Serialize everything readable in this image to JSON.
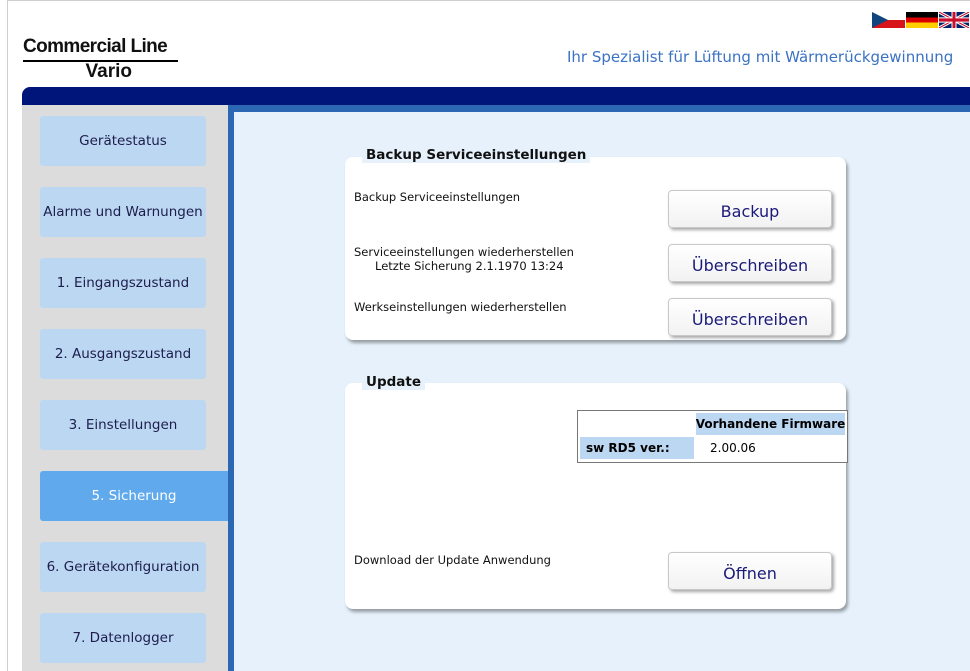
{
  "header": {
    "logo_line1": "Commercial Line",
    "logo_line2": "Vario",
    "tagline": "Ihr Spezialist für Lüftung mit Wärmerückgewinnung",
    "flags": [
      "czech-flag-icon",
      "german-flag-icon",
      "uk-flag-icon"
    ]
  },
  "sidebar": {
    "items": [
      {
        "label": "Gerätestatus",
        "active": false
      },
      {
        "label": "Alarme und Warnungen",
        "active": false
      },
      {
        "label": "1. Eingangszustand",
        "active": false
      },
      {
        "label": "2. Ausgangszustand",
        "active": false
      },
      {
        "label": "3. Einstellungen",
        "active": false
      },
      {
        "label": "5. Sicherung",
        "active": true
      },
      {
        "label": "6. Gerätekonfiguration",
        "active": false
      },
      {
        "label": "7. Datenlogger",
        "active": false
      }
    ]
  },
  "backup": {
    "title": "Backup Serviceeinstellungen",
    "rows": [
      {
        "label": "Backup Serviceeinstellungen",
        "sublabel": "",
        "button": "Backup"
      },
      {
        "label": "Serviceeinstellungen wiederherstellen",
        "sublabel": "Letzte Sicherung 2.1.1970 13:24",
        "button": "Überschreiben"
      },
      {
        "label": "Werkseinstellungen wiederherstellen",
        "sublabel": "",
        "button": "Überschreiben"
      }
    ]
  },
  "update": {
    "title": "Update",
    "table": {
      "header": "Vorhandene Firmware",
      "row_label": "sw RD5 ver.:",
      "row_value": "2.00.06"
    },
    "download_label": "Download der Update Anwendung",
    "download_button": "Öffnen"
  },
  "colors": {
    "top_bar": "#00157a",
    "main_border": "#2b67b3",
    "nav_item": "#bcd7f2",
    "nav_active": "#5fa9ec",
    "tagline": "#3a72c4"
  }
}
